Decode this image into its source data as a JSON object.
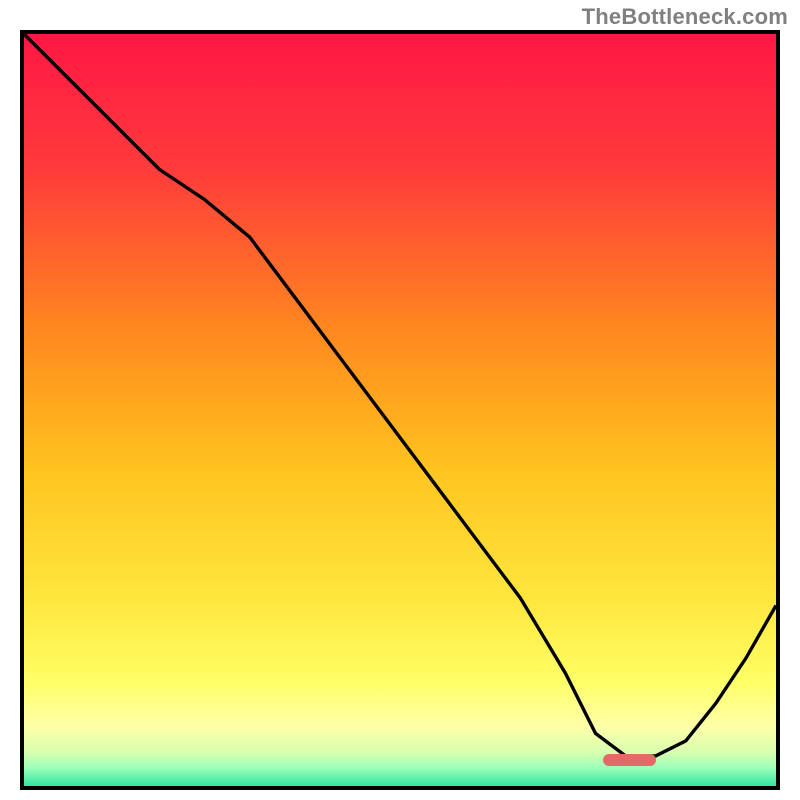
{
  "watermark": "TheBottleneck.com",
  "colors": {
    "border": "#000000",
    "curve": "#000000",
    "watermark": "#808080",
    "marker": "#e46a6a",
    "gradient_stops": [
      {
        "pos": 0.0,
        "color": "#ff1744"
      },
      {
        "pos": 0.18,
        "color": "#ff3b3b"
      },
      {
        "pos": 0.4,
        "color": "#ff8a1f"
      },
      {
        "pos": 0.58,
        "color": "#ffc41f"
      },
      {
        "pos": 0.75,
        "color": "#ffe63d"
      },
      {
        "pos": 0.86,
        "color": "#ffff66"
      },
      {
        "pos": 0.92,
        "color": "#ffffa8"
      },
      {
        "pos": 0.955,
        "color": "#d8ffb0"
      },
      {
        "pos": 0.975,
        "color": "#9fffba"
      },
      {
        "pos": 1.0,
        "color": "#34e6a0"
      }
    ]
  },
  "chart_data": {
    "type": "line",
    "title": "",
    "xlabel": "",
    "ylabel": "",
    "xlim": [
      0,
      100
    ],
    "ylim": [
      0,
      100
    ],
    "note": "No axis labels or ticks are rendered in the image; values are normalized 0–100 estimates read from the plot geometry. y=0 is bottom (green), y=100 is top (red).",
    "series": [
      {
        "name": "curve",
        "x": [
          0,
          6,
          12,
          18,
          24,
          30,
          36,
          42,
          48,
          54,
          60,
          66,
          72,
          76,
          80,
          84,
          88,
          92,
          96,
          100
        ],
        "y": [
          100,
          94,
          88,
          82,
          78,
          73,
          65,
          57,
          49,
          41,
          33,
          25,
          15,
          7,
          4,
          4,
          6,
          11,
          17,
          24
        ]
      }
    ],
    "marker": {
      "name": "optimal-range",
      "x_start": 77,
      "x_end": 84,
      "y": 3.5
    }
  }
}
